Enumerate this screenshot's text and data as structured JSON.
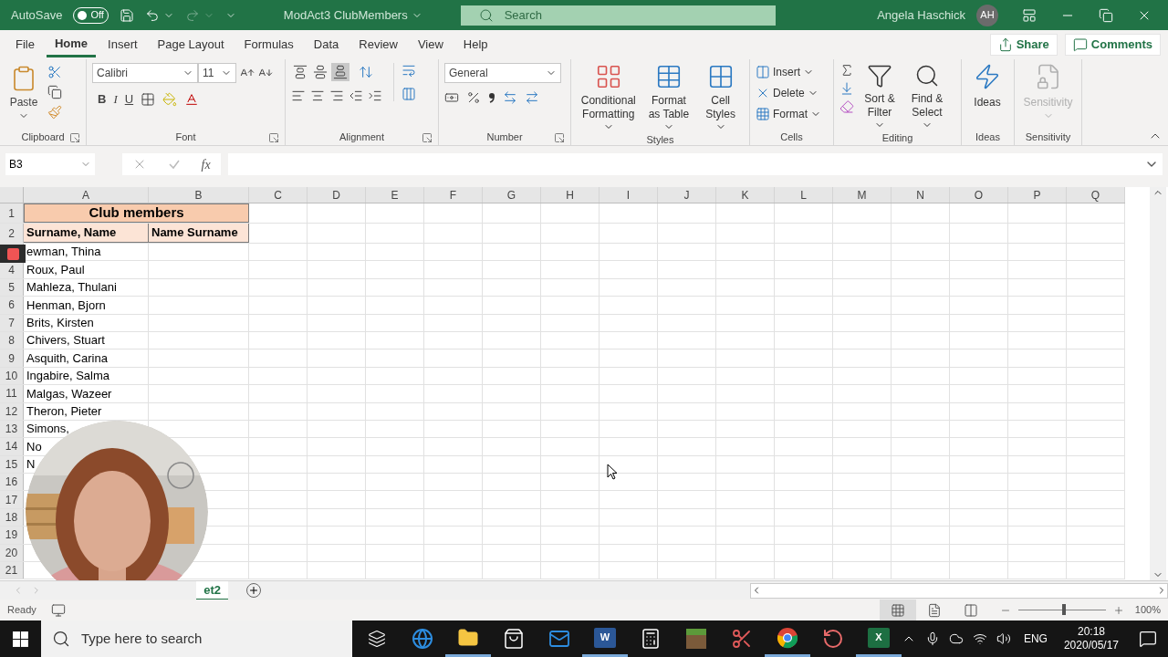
{
  "title_bar": {
    "autosave_label": "AutoSave",
    "autosave": {
      "on": false,
      "label": "Off"
    },
    "document": "ModAct3 ClubMembers",
    "search_placeholder": "Search",
    "user": "Angela Haschick",
    "initials": "AH"
  },
  "menu": {
    "tabs": [
      {
        "label": "File",
        "selected": false
      },
      {
        "label": "Home",
        "selected": true
      },
      {
        "label": "Insert",
        "selected": false
      },
      {
        "label": "Page Layout",
        "selected": false
      },
      {
        "label": "Formulas",
        "selected": false
      },
      {
        "label": "Data",
        "selected": false
      },
      {
        "label": "Review",
        "selected": false
      },
      {
        "label": "View",
        "selected": false
      },
      {
        "label": "Help",
        "selected": false
      }
    ],
    "share": "Share",
    "comments": "Comments"
  },
  "ribbon": {
    "clipboard": {
      "label": "Clipboard",
      "paste": "Paste"
    },
    "font": {
      "label": "Font",
      "name": "Calibri",
      "size": "11",
      "bold": "B",
      "italic": "I",
      "underline": "U"
    },
    "alignment": {
      "label": "Alignment",
      "vertical_align": [
        {
          "selected": false
        },
        {
          "selected": false
        },
        {
          "selected": true
        }
      ]
    },
    "number": {
      "label": "Number",
      "format": "General"
    },
    "styles": {
      "label": "Styles",
      "buttons": [
        "Conditional Formatting",
        "Format as Table",
        "Cell Styles"
      ]
    },
    "cells": {
      "label": "Cells",
      "buttons": [
        "Insert",
        "Delete",
        "Format"
      ]
    },
    "editing": {
      "label": "Editing",
      "buttons": [
        "Sort & Filter",
        "Find & Select"
      ]
    },
    "ideas": {
      "label": "Ideas",
      "button": "Ideas"
    },
    "sensitivity": {
      "label": "Sensitivity",
      "button": "Sensitivity",
      "disabled": true
    }
  },
  "formula_bar": {
    "name_box": "B3",
    "function_label": "fx"
  },
  "sheet": {
    "columns": [
      "A",
      "B",
      "C",
      "D",
      "E",
      "F",
      "G",
      "H",
      "I",
      "J",
      "K",
      "L",
      "M",
      "N",
      "O",
      "P",
      "Q"
    ],
    "rows": [
      {
        "number": "1",
        "kind": "title",
        "cells": [
          "Club members"
        ]
      },
      {
        "number": "2",
        "kind": "header",
        "cells": [
          "Surname, Name",
          "Name Surname"
        ]
      },
      {
        "kind": "data",
        "cells": [
          "ewman, Thina"
        ]
      },
      {
        "number": "4",
        "kind": "data",
        "cells": [
          "Roux, Paul"
        ]
      },
      {
        "number": "5",
        "kind": "data",
        "cells": [
          "Mahleza, Thulani"
        ]
      },
      {
        "number": "6",
        "kind": "data",
        "cells": [
          "Henman, Bjorn"
        ]
      },
      {
        "number": "7",
        "kind": "data",
        "cells": [
          "Brits, Kirsten"
        ]
      },
      {
        "number": "8",
        "kind": "data",
        "cells": [
          "Chivers, Stuart"
        ]
      },
      {
        "number": "9",
        "kind": "data",
        "cells": [
          "Asquith, Carina"
        ]
      },
      {
        "number": "10",
        "kind": "data",
        "cells": [
          "Ingabire, Salma"
        ]
      },
      {
        "number": "11",
        "kind": "data",
        "cells": [
          "Malgas, Wazeer"
        ]
      },
      {
        "number": "12",
        "kind": "data",
        "cells": [
          "Theron, Pieter"
        ]
      },
      {
        "number": "13",
        "kind": "data",
        "cells": [
          "Simons,"
        ]
      },
      {
        "number": "14",
        "kind": "data",
        "cells": [
          "No"
        ]
      },
      {
        "number": "15",
        "kind": "data",
        "cells": [
          "N"
        ]
      },
      {
        "number": "16",
        "kind": "data",
        "cells": []
      },
      {
        "number": "17",
        "kind": "data",
        "cells": []
      },
      {
        "number": "18",
        "kind": "data",
        "cells": []
      },
      {
        "number": "19",
        "kind": "data",
        "cells": []
      },
      {
        "number": "20",
        "kind": "data",
        "cells": []
      },
      {
        "number": "21",
        "kind": "data",
        "cells": []
      }
    ],
    "sheet_tabs": [
      {
        "label": "et2",
        "selected": true
      }
    ]
  },
  "status_bar": {
    "status": "Ready",
    "view_modes": [
      {
        "kind": "normal",
        "selected": true
      },
      {
        "kind": "page-layout",
        "selected": false
      },
      {
        "kind": "page-break",
        "selected": false
      }
    ],
    "zoom": {
      "level": 0.52,
      "label": "100%"
    }
  },
  "taskbar": {
    "search_placeholder": "Type here to search",
    "apps": [
      {
        "kind": "task-view",
        "running": false
      },
      {
        "kind": "edge",
        "running": false
      },
      {
        "kind": "explorer",
        "running": true
      },
      {
        "kind": "store",
        "running": false
      },
      {
        "kind": "mail",
        "running": false
      },
      {
        "kind": "word",
        "running": true,
        "letter": "W"
      },
      {
        "kind": "calculator",
        "running": false
      },
      {
        "kind": "game",
        "running": false
      },
      {
        "kind": "snip",
        "running": false
      },
      {
        "kind": "chrome",
        "running": true
      },
      {
        "kind": "spiral",
        "running": false
      },
      {
        "kind": "excel",
        "running": true,
        "letter": "X"
      }
    ],
    "language": "ENG",
    "time": "20:18",
    "date": "2020/05/17"
  }
}
